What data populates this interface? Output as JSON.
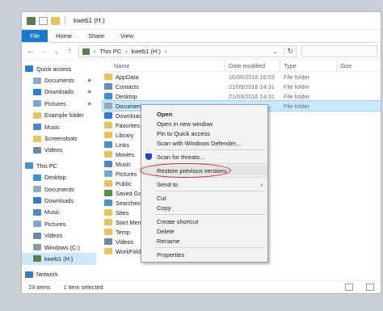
{
  "titlebar": {
    "title": "kweb1 (H:)"
  },
  "ribbon": {
    "tabs": [
      "File",
      "Home",
      "Share",
      "View"
    ]
  },
  "address": {
    "path": [
      "This PC",
      "kweb1 (H:)"
    ]
  },
  "nav": {
    "items": [
      {
        "label": "Quick access",
        "icon": "star-icon",
        "color": "#2a7fd4",
        "indent": 4,
        "pin": false
      },
      {
        "label": "Documents",
        "icon": "documents-icon",
        "color": "#8fa9c6",
        "indent": 14,
        "pin": true
      },
      {
        "label": "Downloads",
        "icon": "downloads-icon",
        "color": "#2a7fd4",
        "indent": 14,
        "pin": true
      },
      {
        "label": "Pictures",
        "icon": "pictures-icon",
        "color": "#7aa6d6",
        "indent": 14,
        "pin": true
      },
      {
        "label": "Example folder",
        "icon": "folder-icon",
        "color": "#e8c35a",
        "indent": 14,
        "pin": false
      },
      {
        "label": "Music",
        "icon": "music-icon",
        "color": "#4b88c9",
        "indent": 14,
        "pin": false
      },
      {
        "label": "Screenshots",
        "icon": "folder-icon",
        "color": "#e8c35a",
        "indent": 14,
        "pin": false
      },
      {
        "label": "Videos",
        "icon": "videos-icon",
        "color": "#6c8aa8",
        "indent": 14,
        "pin": false
      },
      {
        "label": "This PC",
        "icon": "pc-icon",
        "color": "#4a90d0",
        "indent": 4,
        "pin": false
      },
      {
        "label": "Desktop",
        "icon": "desktop-icon",
        "color": "#3d8fd8",
        "indent": 14,
        "pin": false
      },
      {
        "label": "Documents",
        "icon": "documents-icon",
        "color": "#8fa9c6",
        "indent": 14,
        "pin": false
      },
      {
        "label": "Downloads",
        "icon": "downloads-icon",
        "color": "#2a7fd4",
        "indent": 14,
        "pin": false
      },
      {
        "label": "Music",
        "icon": "music-icon",
        "color": "#4b88c9",
        "indent": 14,
        "pin": false
      },
      {
        "label": "Pictures",
        "icon": "pictures-icon",
        "color": "#7aa6d6",
        "indent": 14,
        "pin": false
      },
      {
        "label": "Videos",
        "icon": "videos-icon",
        "color": "#6c8aa8",
        "indent": 14,
        "pin": false
      },
      {
        "label": "Windows (C:)",
        "icon": "drive-icon",
        "color": "#8b9aa8",
        "indent": 14,
        "pin": false
      },
      {
        "label": "kweb1 (H:)",
        "icon": "network-drive-icon",
        "color": "#5b7d52",
        "indent": 14,
        "pin": false,
        "selected": true
      },
      {
        "label": "Network",
        "icon": "network-icon",
        "color": "#3d78b8",
        "indent": 4,
        "pin": false
      }
    ]
  },
  "columns": {
    "name": "Name",
    "date": "Date modified",
    "type": "Type",
    "size": "Size"
  },
  "files": [
    {
      "name": "AppData",
      "date": "16/06/2016 16:03",
      "type": "File folder",
      "color": "#e8c35a"
    },
    {
      "name": "Contacts",
      "date": "21/09/2016 14:31",
      "type": "File folder",
      "color": "#6b8fb8"
    },
    {
      "name": "Desktop",
      "date": "21/09/2016 14:31",
      "type": "File folder",
      "color": "#3d8fd8"
    },
    {
      "name": "Documents",
      "date": "",
      "type": "File folder",
      "color": "#8fa9c6",
      "selected": true
    },
    {
      "name": "Downloads",
      "date": "",
      "type": "",
      "color": "#2a7fd4"
    },
    {
      "name": "Favorites",
      "date": "",
      "type": "",
      "color": "#e8c35a"
    },
    {
      "name": "Library",
      "date": "",
      "type": "",
      "color": "#e8c35a"
    },
    {
      "name": "Links",
      "date": "",
      "type": "",
      "color": "#4a90d0"
    },
    {
      "name": "Movies",
      "date": "",
      "type": "",
      "color": "#e8c35a"
    },
    {
      "name": "Music",
      "date": "",
      "type": "",
      "color": "#4b88c9"
    },
    {
      "name": "Pictures",
      "date": "",
      "type": "",
      "color": "#7aa6d6"
    },
    {
      "name": "Public",
      "date": "",
      "type": "",
      "color": "#e8c35a"
    },
    {
      "name": "Saved Gam",
      "date": "",
      "type": "",
      "color": "#5a8c4a"
    },
    {
      "name": "Searches",
      "date": "",
      "type": "",
      "color": "#4a90d0"
    },
    {
      "name": "Sites",
      "date": "",
      "type": "",
      "color": "#e8c35a"
    },
    {
      "name": "Start Menu",
      "date": "",
      "type": "",
      "color": "#e8c35a"
    },
    {
      "name": "Temp",
      "date": "",
      "type": "",
      "color": "#e8c35a"
    },
    {
      "name": "Videos",
      "date": "",
      "type": "",
      "color": "#6c8aa8"
    },
    {
      "name": "WorkFolde",
      "date": "",
      "type": "",
      "color": "#e8c35a"
    }
  ],
  "context_menu": {
    "items": [
      {
        "label": "Open",
        "bold": true
      },
      {
        "label": "Open in new window"
      },
      {
        "label": "Pin to Quick access"
      },
      {
        "label": "Scan with Windows Defender..."
      },
      {
        "sep": true
      },
      {
        "label": "Scan for threats...",
        "icon": "shield-icon"
      },
      {
        "sep": true
      },
      {
        "label": "Restore previous versions",
        "highlight": true
      },
      {
        "sep": true
      },
      {
        "label": "Send to",
        "submenu": true
      },
      {
        "sep": true
      },
      {
        "label": "Cut"
      },
      {
        "label": "Copy"
      },
      {
        "sep": true
      },
      {
        "label": "Create shortcut"
      },
      {
        "label": "Delete"
      },
      {
        "label": "Rename"
      },
      {
        "sep": true
      },
      {
        "label": "Properties"
      }
    ]
  },
  "status": {
    "count": "19 items",
    "selected": "1 item selected"
  },
  "colors": {
    "accent": "#1979ca",
    "selection": "#cce8ff",
    "highlight_ring": "#d9262b"
  }
}
